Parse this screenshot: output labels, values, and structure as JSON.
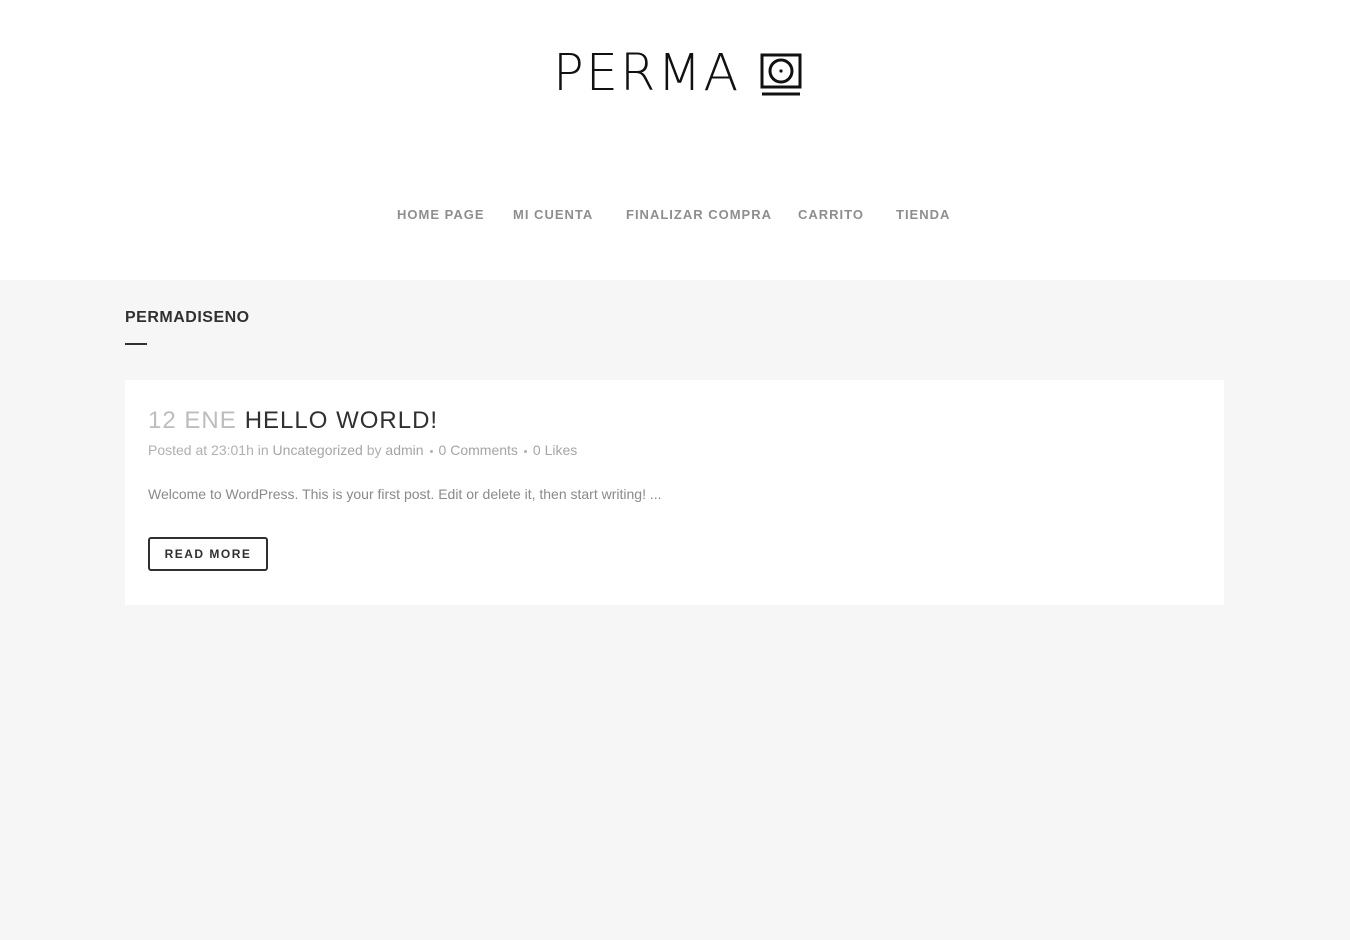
{
  "header": {
    "logo_text": "PERMA",
    "nav": [
      {
        "label": "HOME PAGE"
      },
      {
        "label": "MI CUENTA"
      },
      {
        "label": "FINALIZAR COMPRA"
      },
      {
        "label": "CARRITO"
      },
      {
        "label": "TIENDA"
      }
    ]
  },
  "main": {
    "section_title": "PERMADISENO",
    "post": {
      "date": "12 ENE",
      "title": "HELLO WORLD!",
      "meta": {
        "posted_at_prefix": "Posted at 23:01h in",
        "category": "Uncategorized",
        "by_text": "by",
        "author": "admin",
        "comments": "0 Comments",
        "likes": "0 Likes"
      },
      "excerpt": "Welcome to WordPress. This is your first post. Edit or delete it, then start writing! ...",
      "read_more_label": "READ MORE"
    }
  }
}
